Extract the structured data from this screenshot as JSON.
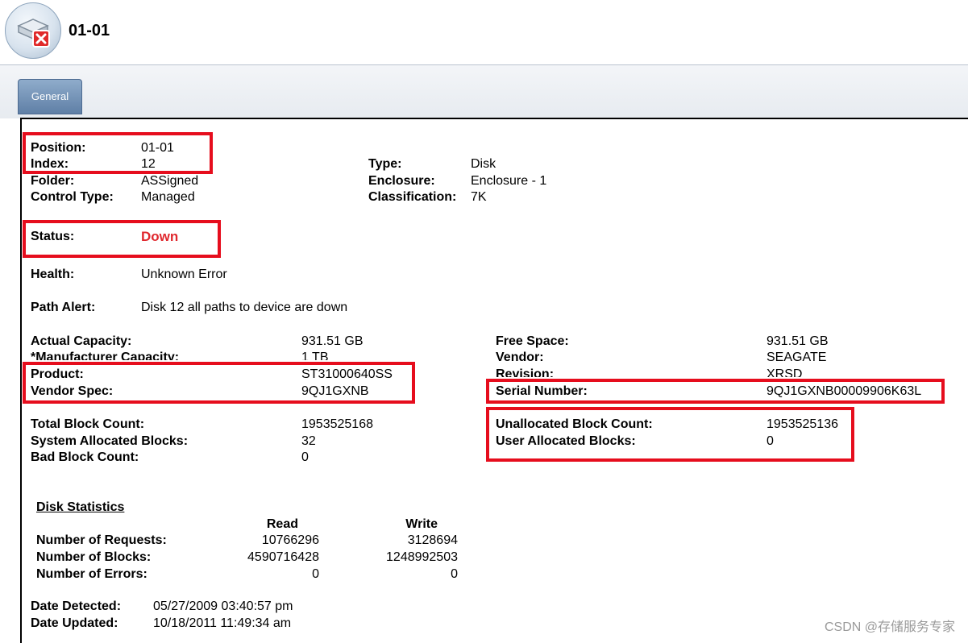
{
  "header": {
    "title": "01-01",
    "icon": "disk-error-icon"
  },
  "tabs": [
    {
      "label": "General"
    }
  ],
  "labels": {
    "position": "Position:",
    "index": "Index:",
    "folder": "Folder:",
    "control_type": "Control Type:",
    "type": "Type:",
    "enclosure": "Enclosure:",
    "classification": "Classification:",
    "status": "Status:",
    "health": "Health:",
    "path_alert": "Path Alert:",
    "actual_capacity": "Actual Capacity:",
    "manufacturer_capacity": "*Manufacturer Capacity:",
    "product": "Product:",
    "vendor_spec": "Vendor Spec:",
    "free_space": "Free Space:",
    "vendor": "Vendor:",
    "revision": "Revision:",
    "serial_number": "Serial Number:",
    "total_block_count": "Total Block Count:",
    "system_allocated_blocks": "System Allocated Blocks:",
    "bad_block_count": "Bad Block Count:",
    "unallocated_block_count": "Unallocated Block Count:",
    "user_allocated_blocks": "User Allocated Blocks:",
    "date_detected": "Date Detected:",
    "date_updated": "Date Updated:"
  },
  "values": {
    "position": "01-01",
    "index": "12",
    "folder": "ASSigned",
    "control_type": "Managed",
    "type": "Disk",
    "enclosure": "Enclosure - 1",
    "classification": "7K",
    "status": "Down",
    "health": "Unknown Error",
    "path_alert": "Disk 12 all paths to device are down",
    "actual_capacity": "931.51 GB",
    "manufacturer_capacity": "1 TB",
    "product": "ST31000640SS",
    "vendor_spec": "9QJ1GXNB",
    "free_space": "931.51 GB",
    "vendor": "SEAGATE",
    "revision": "XRSD",
    "serial_number": "9QJ1GXNB00009906K63L",
    "total_block_count": "1953525168",
    "system_allocated_blocks": "32",
    "bad_block_count": "0",
    "unallocated_block_count": "1953525136",
    "user_allocated_blocks": "0",
    "date_detected": "05/27/2009 03:40:57 pm",
    "date_updated": "10/18/2011 11:49:34 am"
  },
  "disk_statistics": {
    "title": "Disk Statistics",
    "columns": [
      "Read",
      "Write"
    ],
    "rows": [
      {
        "label": "Number of Requests:",
        "read": "10766296",
        "write": "3128694"
      },
      {
        "label": "Number of Blocks:",
        "read": "4590716428",
        "write": "1248992503"
      },
      {
        "label": "Number of Errors:",
        "read": "0",
        "write": "0"
      }
    ]
  },
  "colors": {
    "status_down": "#e0282e",
    "highlight_box": "#e60d1d",
    "tab": "#6f8db3"
  },
  "watermark": "CSDN @存储服务专家"
}
